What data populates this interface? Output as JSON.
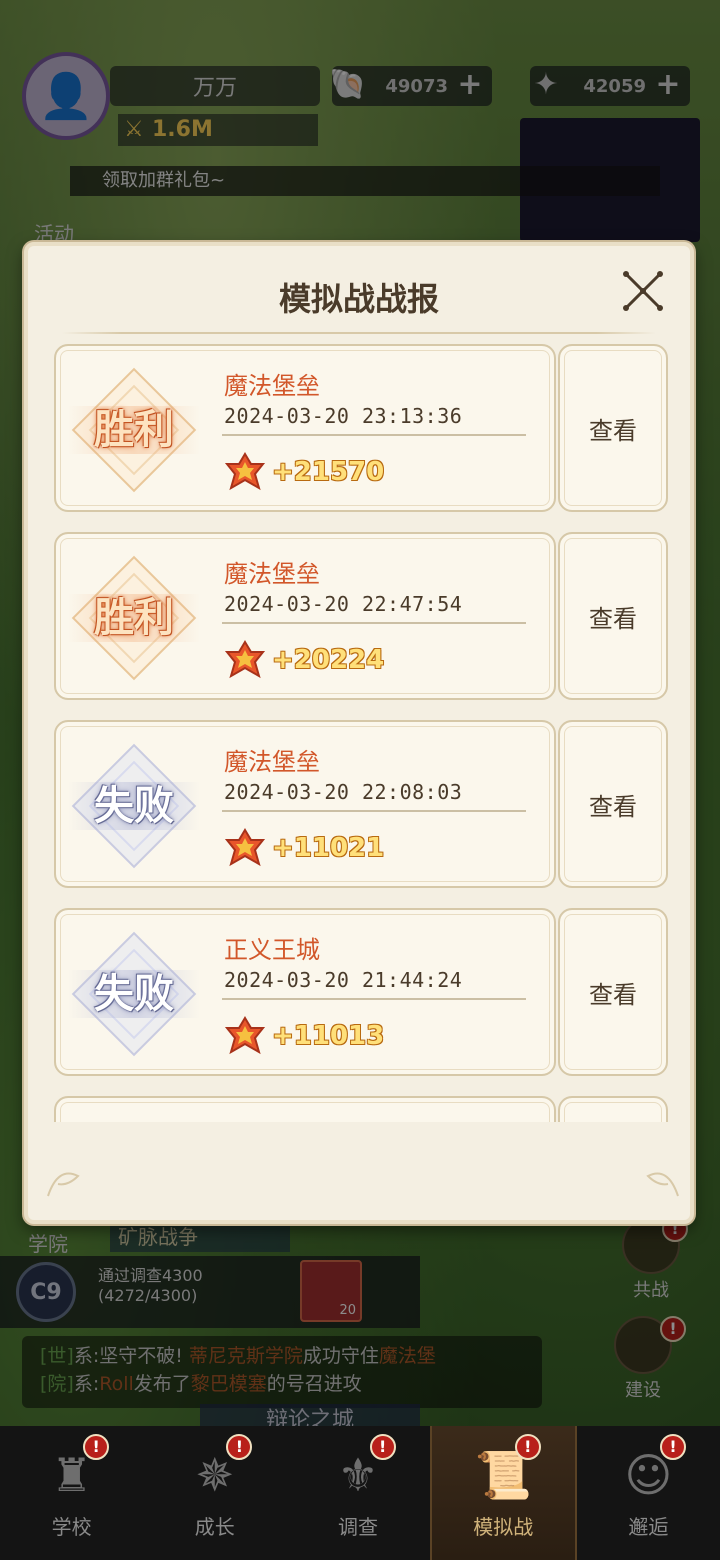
{
  "hud": {
    "player_name": "万万",
    "power": "1.6M",
    "resource_1": "49073",
    "resource_2": "42059",
    "banner": "领取加群礼包~",
    "activity_label": "活动"
  },
  "modal": {
    "title": "模拟战战报",
    "view_label": "查看",
    "records": [
      {
        "result": "胜利",
        "outcome": "win",
        "map": "魔法堡垒",
        "time": "2024-03-20  23:13:36",
        "reward": "+21570"
      },
      {
        "result": "胜利",
        "outcome": "win",
        "map": "魔法堡垒",
        "time": "2024-03-20  22:47:54",
        "reward": "+20224"
      },
      {
        "result": "失败",
        "outcome": "loss",
        "map": "魔法堡垒",
        "time": "2024-03-20  22:08:03",
        "reward": "+11021"
      },
      {
        "result": "失败",
        "outcome": "loss",
        "map": "正义王城",
        "time": "2024-03-20  21:44:24",
        "reward": "+11013"
      }
    ]
  },
  "lower_hud": {
    "academy_label": "学院",
    "event_label": "矿脉战争",
    "quest_level": "C9",
    "quest_line_1": "通过调查4300",
    "quest_line_2": "(4272/4300)",
    "quest_reward_count": "20",
    "side_btn_1": "共战",
    "side_btn_2": "建设",
    "chat_1_channel": "[世]",
    "chat_1_a": "系:坚守不破! ",
    "chat_1_b": "蒂尼克斯学院",
    "chat_1_c": "成功守住",
    "chat_1_d": "魔法堡",
    "chat_2_channel": "[院]",
    "chat_2_a": "系:",
    "chat_2_b": "Roll",
    "chat_2_c": "发布了",
    "chat_2_d": "黎巴模塞",
    "chat_2_e": "的号召进攻",
    "city_label": "辩论之城",
    "alert_mark": "!"
  },
  "bottom_nav": [
    {
      "label": "学校",
      "icon": "castle-icon",
      "active": false
    },
    {
      "label": "成长",
      "icon": "compass-icon",
      "active": false
    },
    {
      "label": "调查",
      "icon": "fleur-icon",
      "active": false
    },
    {
      "label": "模拟战",
      "icon": "scroll-icon",
      "active": true
    },
    {
      "label": "邂逅",
      "icon": "portrait-icon",
      "active": false
    }
  ],
  "colors": {
    "accent_orange": "#d2572a",
    "reward_gold": "#ffe07a",
    "panel_bg": "#f4efe2"
  }
}
